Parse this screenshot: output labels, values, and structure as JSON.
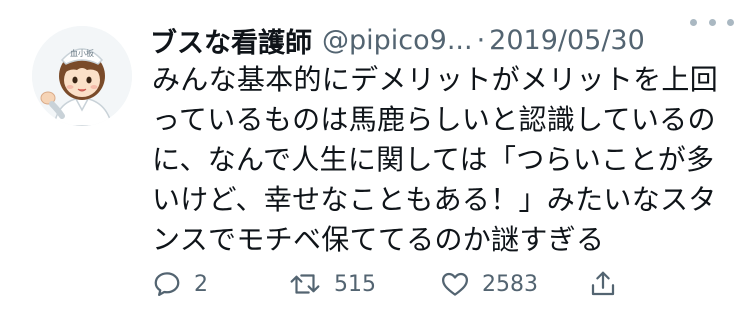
{
  "tweet": {
    "display_name": "ブスな看護師",
    "handle": "@pipico9...",
    "separator": "·",
    "date": "2019/05/30",
    "text": "みんな基本的にデメリットがメリットを上回っているものは馬鹿らしいと認識しているのに、なんで人生に関しては「つらいことが多いけど、幸せなこともある！」みたいなスタンスでモチベ保ててるのか謎すぎる",
    "avatar_text": "血小板",
    "icons": {
      "more": "more-dots-icon",
      "reply": "reply-icon",
      "retweet": "retweet-icon",
      "like": "heart-icon",
      "share": "share-icon"
    },
    "counts": {
      "reply": "2",
      "retweet": "515",
      "like": "2583"
    },
    "colors": {
      "text": "#0f1419",
      "secondary": "#536471",
      "icon": "#536471"
    }
  }
}
